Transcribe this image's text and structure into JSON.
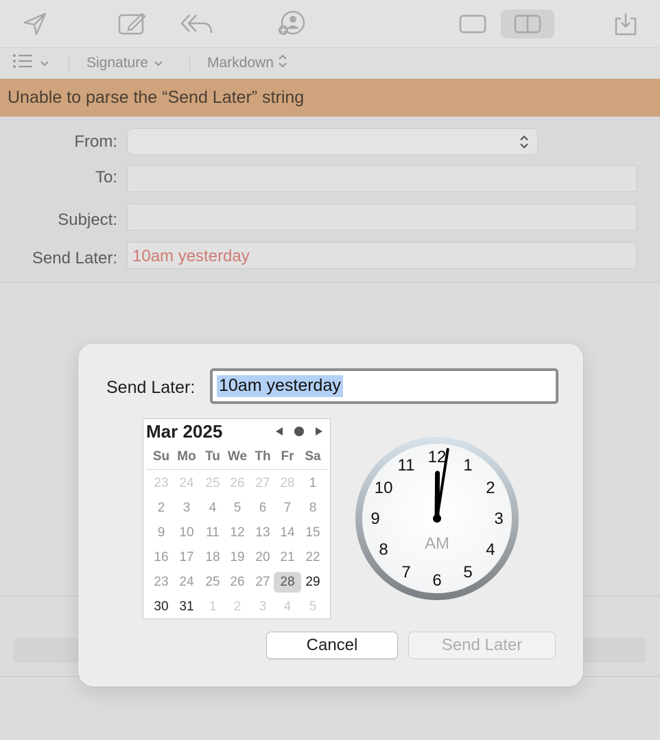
{
  "toolbar": {
    "icons": [
      "send-icon",
      "compose-icon",
      "reply-all-icon",
      "contacts-icon",
      "single-pane-icon",
      "split-pane-icon",
      "download-icon"
    ]
  },
  "format_bar": {
    "signature_label": "Signature",
    "markdown_label": "Markdown"
  },
  "banner": {
    "message": "Unable to parse the “Send Later” string",
    "color": "#cfa47c"
  },
  "headers": {
    "from_label": "From:",
    "from_value": "",
    "to_label": "To:",
    "to_value": "",
    "subject_label": "Subject:",
    "subject_value": "",
    "send_later_label": "Send Later:",
    "send_later_value": "10am yesterday",
    "error_color": "#cf7c74"
  },
  "dialog": {
    "label": "Send Later:",
    "input_value": "10am yesterday",
    "calendar": {
      "title": "Mar 2025",
      "weekdays": [
        "Su",
        "Mo",
        "Tu",
        "We",
        "Th",
        "Fr",
        "Sa"
      ],
      "weeks": [
        [
          "23",
          "24",
          "25",
          "26",
          "27",
          "28",
          "1"
        ],
        [
          "2",
          "3",
          "4",
          "5",
          "6",
          "7",
          "8"
        ],
        [
          "9",
          "10",
          "11",
          "12",
          "13",
          "14",
          "15"
        ],
        [
          "16",
          "17",
          "18",
          "19",
          "20",
          "21",
          "22"
        ],
        [
          "23",
          "24",
          "25",
          "26",
          "27",
          "28",
          "29"
        ],
        [
          "30",
          "31",
          "1",
          "2",
          "3",
          "4",
          "5"
        ]
      ],
      "today": "28"
    },
    "clock": {
      "numbers": [
        "12",
        "1",
        "2",
        "3",
        "4",
        "5",
        "6",
        "7",
        "8",
        "9",
        "10",
        "11"
      ],
      "period": "AM",
      "hour": 12,
      "minute": 1
    },
    "cancel_label": "Cancel",
    "send_later_button_label": "Send Later"
  }
}
